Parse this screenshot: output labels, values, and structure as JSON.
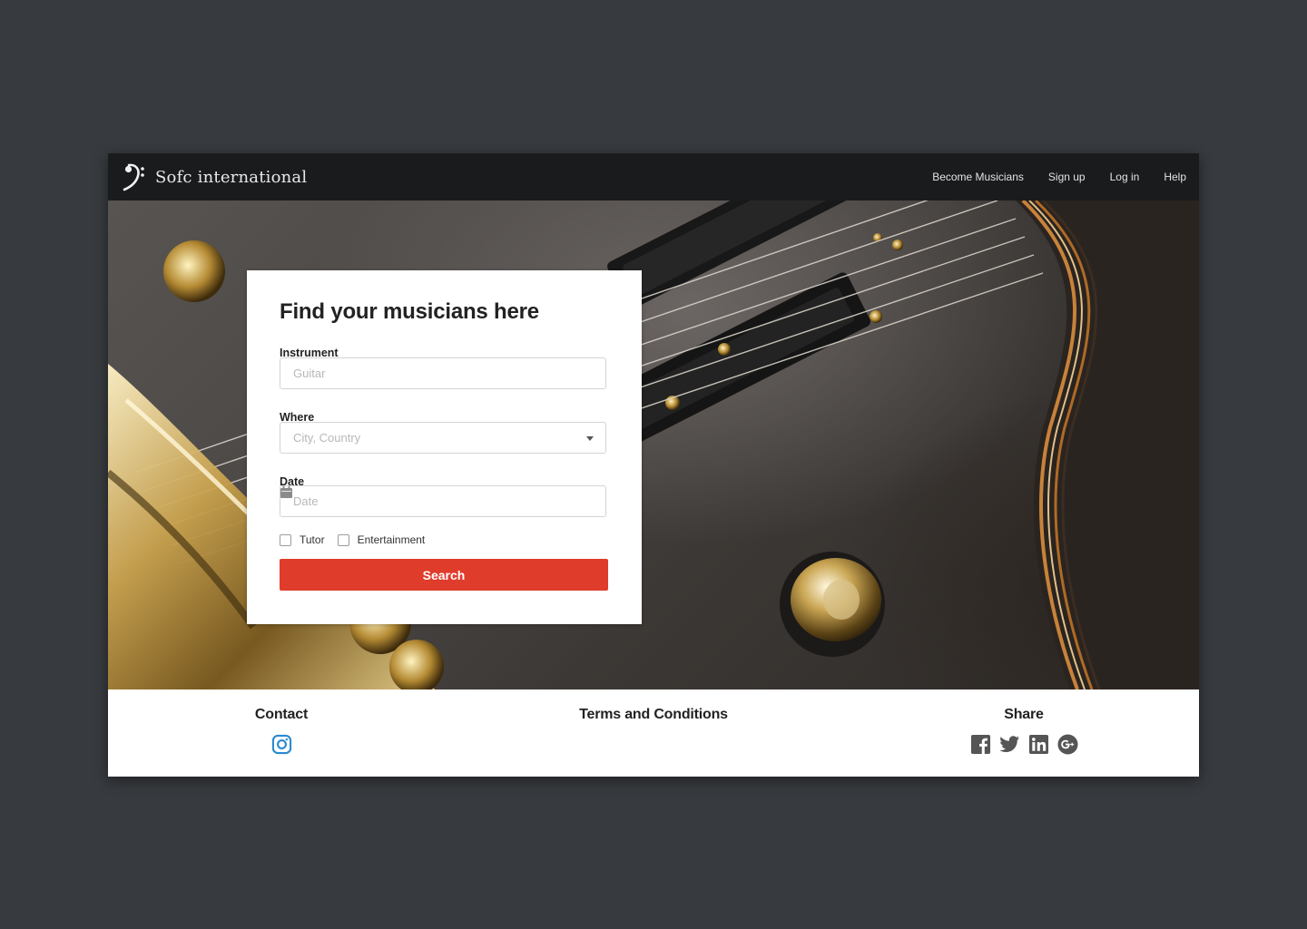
{
  "brand": {
    "name": "Sofc international",
    "logo_icon": "bass-clef-icon"
  },
  "nav": {
    "items": [
      {
        "label": "Become Musicians"
      },
      {
        "label": "Sign up"
      },
      {
        "label": "Log in"
      },
      {
        "label": "Help"
      }
    ]
  },
  "search": {
    "title": "Find your musicians here",
    "instrument": {
      "label": "Instrument",
      "placeholder": "Guitar",
      "value": ""
    },
    "where": {
      "label": "Where",
      "placeholder": "City, Country",
      "value": ""
    },
    "date": {
      "label": "Date",
      "placeholder": "Date",
      "value": "",
      "icon": "calendar-icon"
    },
    "options": [
      {
        "label": "Tutor",
        "checked": false
      },
      {
        "label": "Entertainment",
        "checked": false
      }
    ],
    "submit_label": "Search",
    "submit_color": "#e03c2b"
  },
  "footer": {
    "contact": {
      "title": "Contact",
      "icons": [
        "instagram-icon"
      ]
    },
    "terms": {
      "title": "Terms and Conditions"
    },
    "share": {
      "title": "Share",
      "icons": [
        "facebook-icon",
        "twitter-icon",
        "linkedin-icon",
        "google-plus-icon"
      ]
    }
  },
  "colors": {
    "page_background": "#373a3e",
    "nav_background": "#1a1b1d",
    "accent": "#e03c2b",
    "instagram": "#2a8ad1",
    "share_icons": "#555555"
  }
}
